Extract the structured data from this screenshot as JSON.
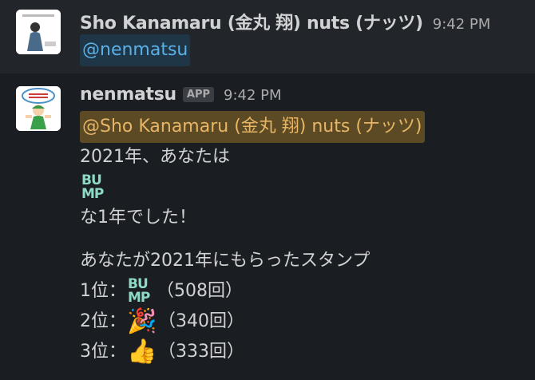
{
  "messages": [
    {
      "sender": "Sho Kanamaru (金丸 翔) nuts (ナッツ)",
      "time": "9:42 PM",
      "mention": "@nenmatsu"
    },
    {
      "sender": "nenmatsu",
      "badge": "APP",
      "time": "9:42 PM",
      "mention": "@Sho Kanamaru (金丸 翔) nuts (ナッツ)",
      "line1": "2021年、あなたは",
      "bump_top": "BU",
      "bump_bottom": "MP",
      "line3": "な1年でした！",
      "line4": "あなたが2021年にもらったスタンプ",
      "rankings": [
        {
          "rank": "1位：",
          "emoji": "bump",
          "count": "（508回）"
        },
        {
          "rank": "2位：",
          "emoji": "🎉",
          "count": "（340回）"
        },
        {
          "rank": "3位：",
          "emoji": "👍",
          "count": "（333回）"
        }
      ]
    }
  ],
  "colors": {
    "background": "#1a1d21",
    "mention_blue": "#5bb0e6",
    "mention_yellow": "#e8b567",
    "bump": "#8ed9c7"
  }
}
